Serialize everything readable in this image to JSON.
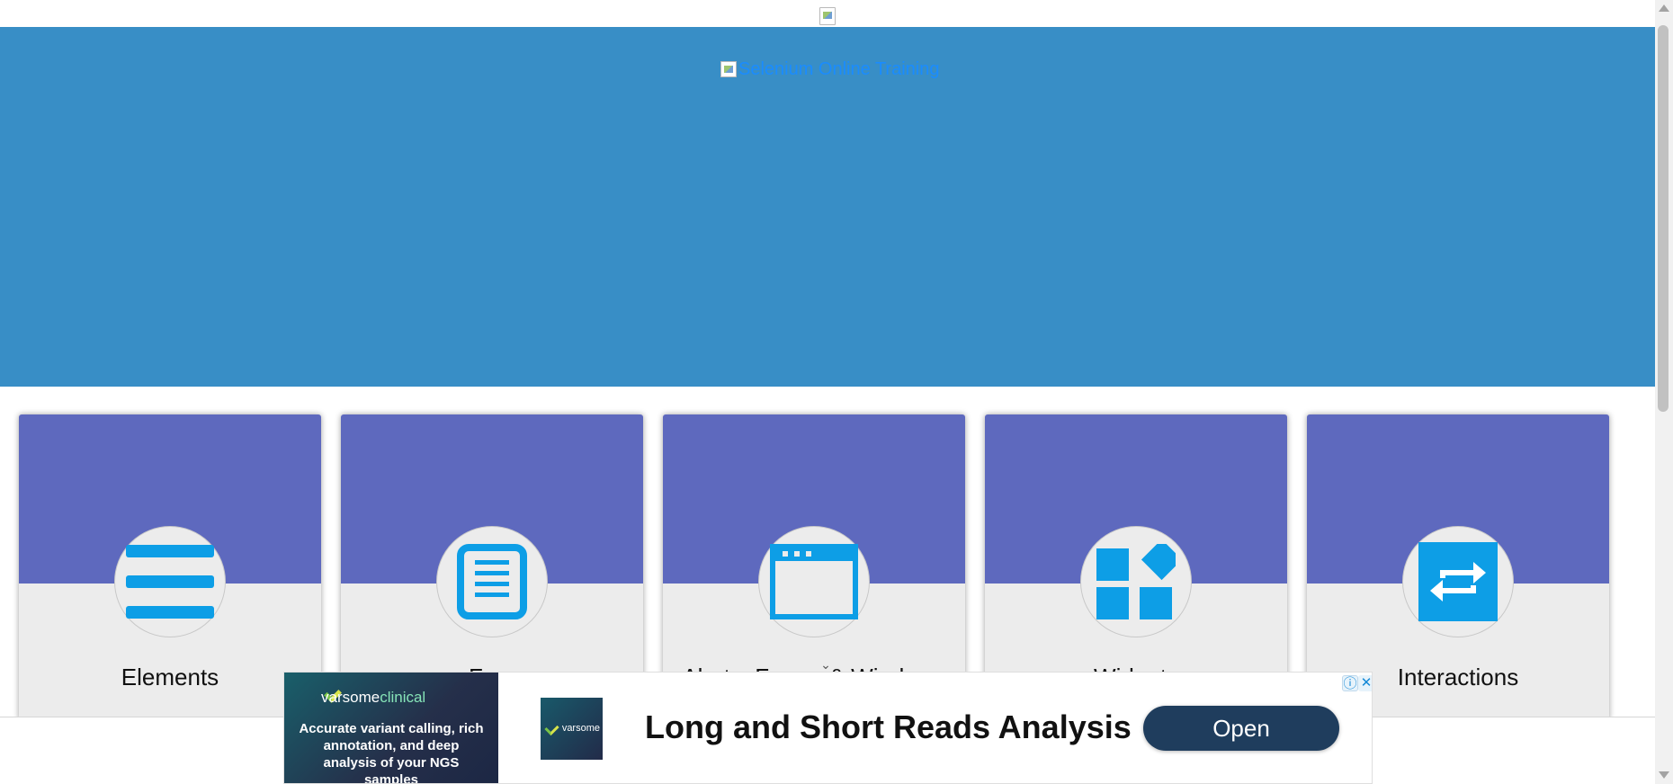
{
  "header": {
    "top_logo_icon": "broken-image-icon",
    "banner_link_text": "Selenium Online Training",
    "banner_color": "#388ec6"
  },
  "cards": [
    {
      "title": "Elements",
      "icon": "menu-lines-icon"
    },
    {
      "title": "Fo...",
      "icon": "document-form-icon"
    },
    {
      "title": "Alerts, Frame & Windows",
      "icon": "browser-window-icon"
    },
    {
      "title": "Widgets",
      "icon": "widgets-grid-icon"
    },
    {
      "title": "Interactions",
      "icon": "arrows-swap-icon"
    }
  ],
  "ad": {
    "brand_primary": "varsome",
    "brand_secondary": "clinical",
    "description": "Accurate variant calling, rich annotation, and deep analysis of your NGS samples",
    "thumb_brand": "varsome",
    "headline": "Long and Short Reads Analysis",
    "button_label": "Open",
    "info_icon": "info-icon",
    "close_icon": "close-icon"
  },
  "colors": {
    "card_header": "#5e69be",
    "card_body": "#ececec",
    "icon_blue": "#0d9ee6",
    "ad_button": "#1f3d5d"
  }
}
